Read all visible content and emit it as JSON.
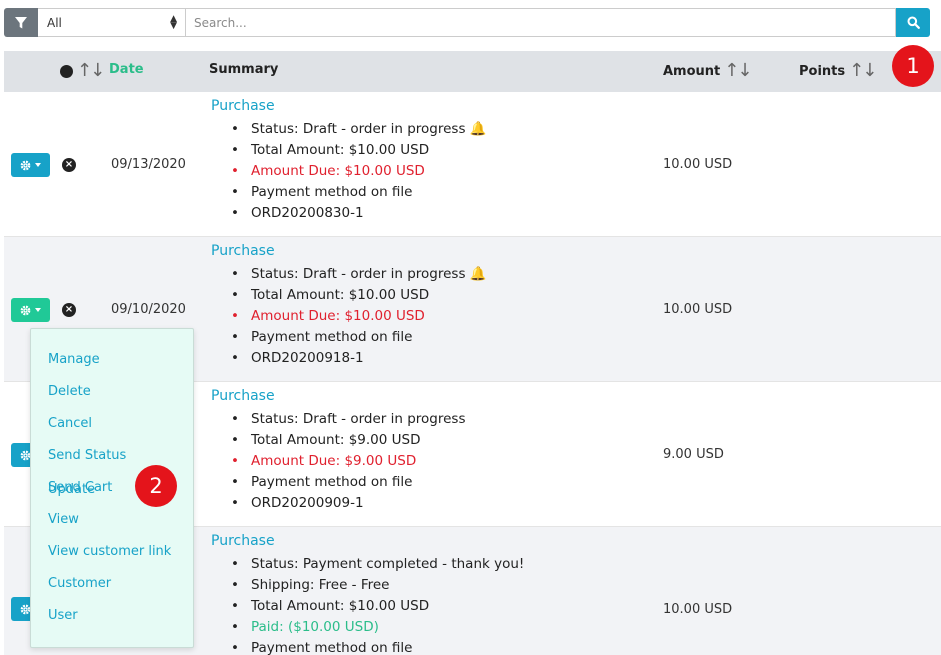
{
  "filter": {
    "select_value": "All",
    "search_placeholder": "Search..."
  },
  "table": {
    "headers": {
      "date": "Date",
      "summary": "Summary",
      "amount": "Amount",
      "points": "Points"
    },
    "rows": [
      {
        "date": "09/13/2020",
        "amount": "10.00 USD",
        "title": "Purchase",
        "lines": [
          "Status: Draft - order in progress",
          "Total Amount: $10.00 USD",
          "Amount Due: $10.00 USD",
          "Payment method on file",
          "ORD20200830-1"
        ]
      },
      {
        "date": "09/10/2020",
        "amount": "10.00 USD",
        "title": "Purchase",
        "lines": [
          "Status: Draft - order in progress",
          "Total Amount: $10.00 USD",
          "Amount Due: $10.00 USD",
          "Payment method on file",
          "ORD20200918-1"
        ]
      },
      {
        "date": "",
        "amount": "9.00 USD",
        "title": "Purchase",
        "lines": [
          "Status: Draft - order in progress",
          "Total Amount: $9.00 USD",
          "Amount Due: $9.00 USD",
          "Payment method on file",
          "ORD20200909-1"
        ]
      },
      {
        "date": "",
        "amount": "10.00 USD",
        "title": "Purchase",
        "lines": [
          "Status: Payment completed - thank you!",
          "Shipping: Free - Free",
          "Total Amount: $10.00 USD",
          "Paid: ($10.00 USD)",
          "Payment method on file"
        ]
      }
    ]
  },
  "dropdown": {
    "items": [
      "Manage",
      "Delete",
      "Cancel",
      "Send Status Update",
      "Send Cart",
      "View",
      "View customer link",
      "Customer",
      "User"
    ]
  },
  "badges": [
    "1",
    "2"
  ],
  "colors": {
    "accent": "#17a2c8",
    "active_button": "#20c997",
    "due_red": "#e0202e",
    "paid_green": "#2bbd8a",
    "badge_red": "#e4141b"
  },
  "icons": [
    "filter-icon",
    "search-icon",
    "gear-icon",
    "close-circle-icon",
    "bell-icon",
    "sort-icon"
  ]
}
